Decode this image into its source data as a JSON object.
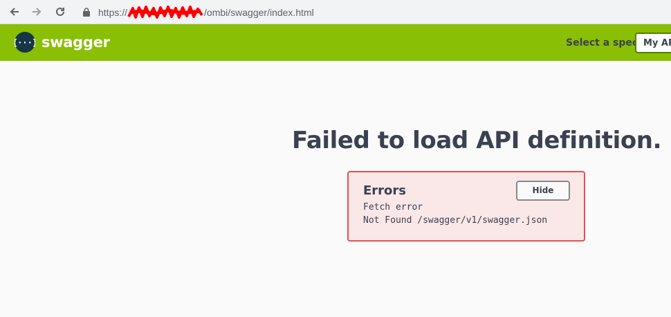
{
  "browser": {
    "url_prefix": "https://",
    "url_path": "/ombi/swagger/index.html",
    "icons": [
      "back-arrow-icon",
      "forward-arrow-icon",
      "reload-icon",
      "lock-icon"
    ],
    "redaction_color": "#ff0000"
  },
  "topbar": {
    "brand": "swagger",
    "spec_label": "Select a spec",
    "spec_selected": "My API",
    "background_color": "#89bf04"
  },
  "main": {
    "title": "Failed to load API definition."
  },
  "errors": {
    "heading": "Errors",
    "hide_label": "Hide",
    "messages": [
      "Fetch error",
      "Not Found /swagger/v1/swagger.json"
    ],
    "border_color": "#e34f4f",
    "background_color": "#fae7e7"
  }
}
